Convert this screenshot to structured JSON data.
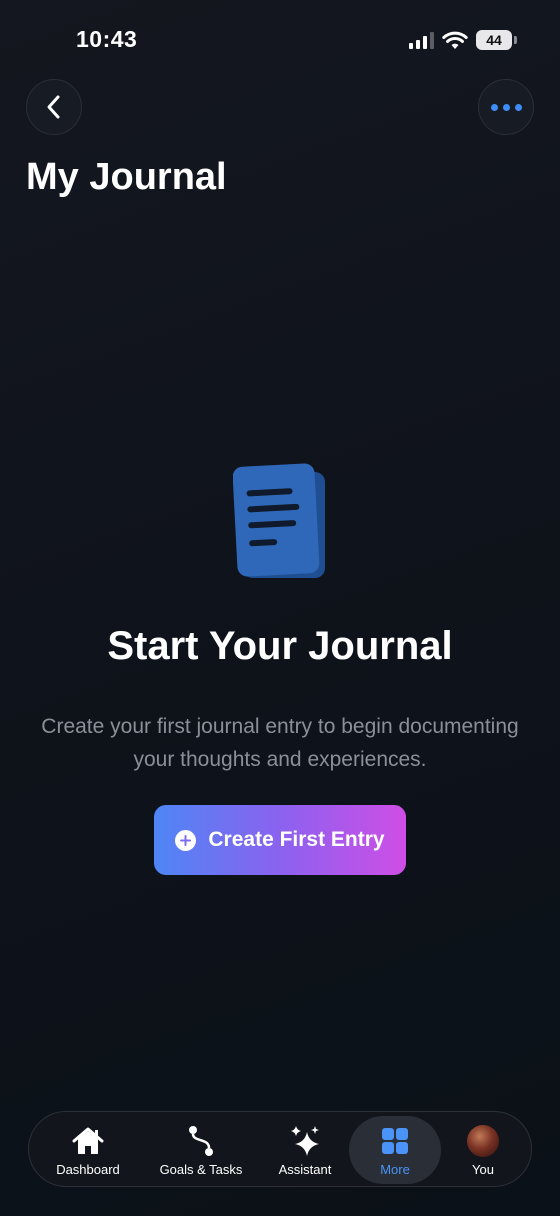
{
  "status_bar": {
    "time": "10:43",
    "battery": "44",
    "icons": [
      "signal-icon",
      "wifi-icon",
      "battery-icon"
    ]
  },
  "header": {
    "title": "My Journal",
    "back_icon": "chevron-left-icon",
    "more_icon": "ellipsis-icon"
  },
  "empty_state": {
    "icon": "document-icon",
    "title": "Start Your Journal",
    "description": "Create your first journal entry to begin documenting your thoughts and experiences.",
    "button_label": "Create First Entry",
    "button_icon": "plus-circle-icon"
  },
  "tab_bar": {
    "items": [
      {
        "label": "Dashboard",
        "icon": "house-icon",
        "active": false
      },
      {
        "label": "Goals & Tasks",
        "icon": "route-icon",
        "active": false
      },
      {
        "label": "Assistant",
        "icon": "sparkles-icon",
        "active": false
      },
      {
        "label": "More",
        "icon": "grid-icon",
        "active": true
      },
      {
        "label": "You",
        "icon": "avatar",
        "active": false
      }
    ]
  },
  "colors": {
    "background": "#11151c",
    "accent_blue": "#3e8ef7",
    "gradient_start": "#4e86f5",
    "gradient_end": "#cf4ee6",
    "muted_text": "#8b8f98",
    "icon_blue": "#2f68b8"
  }
}
